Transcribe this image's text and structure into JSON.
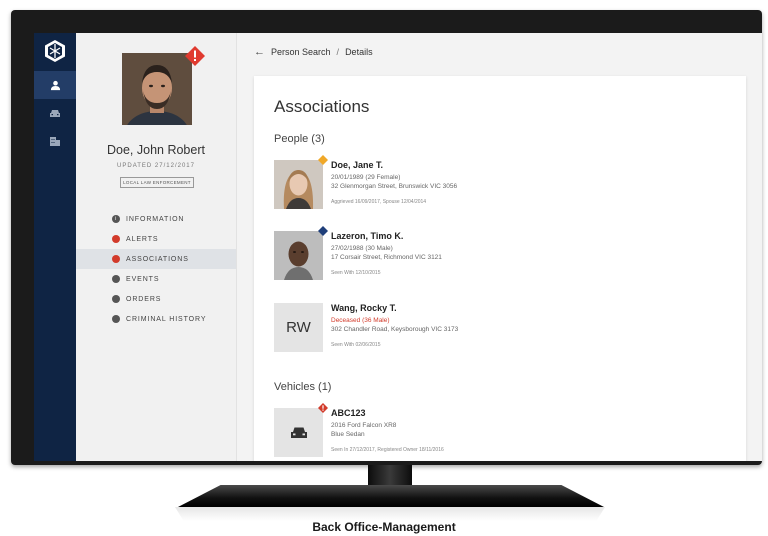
{
  "breadcrumb": {
    "back_icon": "arrow-left-icon",
    "parent": "Person Search",
    "separator": "/",
    "current": "Details"
  },
  "profile": {
    "name": "Doe, John Robert",
    "updated": "UPDATED 27/12/2017",
    "tag": "LOCAL LAW ENFORCEMENT",
    "alert_icon": "alert-diamond-icon"
  },
  "nav": [
    {
      "label": "INFORMATION",
      "badge": "",
      "badge_color": "#555555"
    },
    {
      "label": "ALERTS",
      "badge": "",
      "badge_color": "#d23b2b"
    },
    {
      "label": "ASSOCIATIONS",
      "badge": "",
      "badge_color": "#d23b2b"
    },
    {
      "label": "EVENTS",
      "badge": "",
      "badge_color": "#555555"
    },
    {
      "label": "ORDERS",
      "badge": "",
      "badge_color": "#555555"
    },
    {
      "label": "CRIMINAL HISTORY",
      "badge": "",
      "badge_color": "#555555"
    }
  ],
  "rail": {
    "icons": [
      "brand-logo-icon",
      "person-icon",
      "car-icon",
      "building-icon"
    ]
  },
  "main": {
    "title": "Associations",
    "people_heading": "People (3)",
    "people": [
      {
        "name": "Doe, Jane T.",
        "line1": "20/01/1989 (29 Female)",
        "line2": "32 Glenmorgan Street, Brunswick VIC 3056",
        "note": "Aggrieved 16/09/2017, Spouse 12/04/2014",
        "corner_color": "#f0a828"
      },
      {
        "name": "Lazeron, Timo K.",
        "line1": "27/02/1988 (30 Male)",
        "line2": "17 Corsair Street, Richmond VIC 3121",
        "note": "Seen With 12/10/2015",
        "corner_color": "#1f3f7a"
      },
      {
        "name": "Wang, Rocky T.",
        "initials": "RW",
        "line1": "Deceased (36 Male)",
        "line2": "302 Chandler Road, Keysborough VIC 3173",
        "note": "Seen With 02/06/2015"
      }
    ],
    "vehicles_heading": "Vehicles (1)",
    "vehicles": [
      {
        "plate": "ABC123",
        "line1": "2016 Ford Falcon XR8",
        "line2": "Blue Sedan",
        "note": "Seen In 27/12/2017, Registered Owner 18/11/2016",
        "corner_color": "#d23b2b",
        "icon": "car-icon"
      }
    ]
  },
  "caption": "Back Office-Management"
}
